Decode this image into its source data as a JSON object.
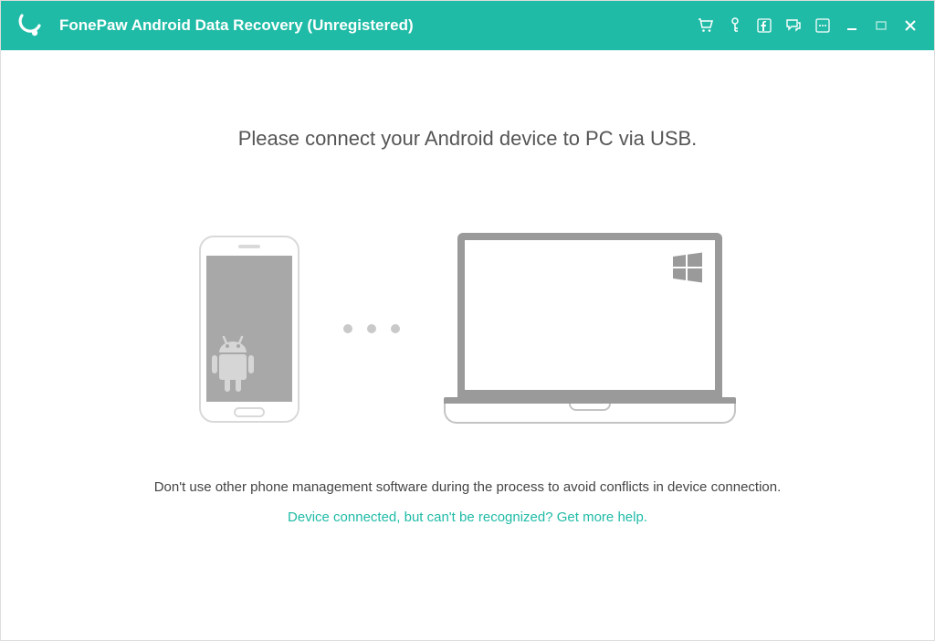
{
  "header": {
    "title": "FonePaw Android Data Recovery (Unregistered)"
  },
  "main": {
    "heading": "Please connect your Android device to PC via USB.",
    "warning": "Don't use other phone management software during the process to avoid conflicts in device connection.",
    "help_link": "Device connected, but can't be recognized? Get more help."
  },
  "colors": {
    "accent": "#1fbba6"
  }
}
